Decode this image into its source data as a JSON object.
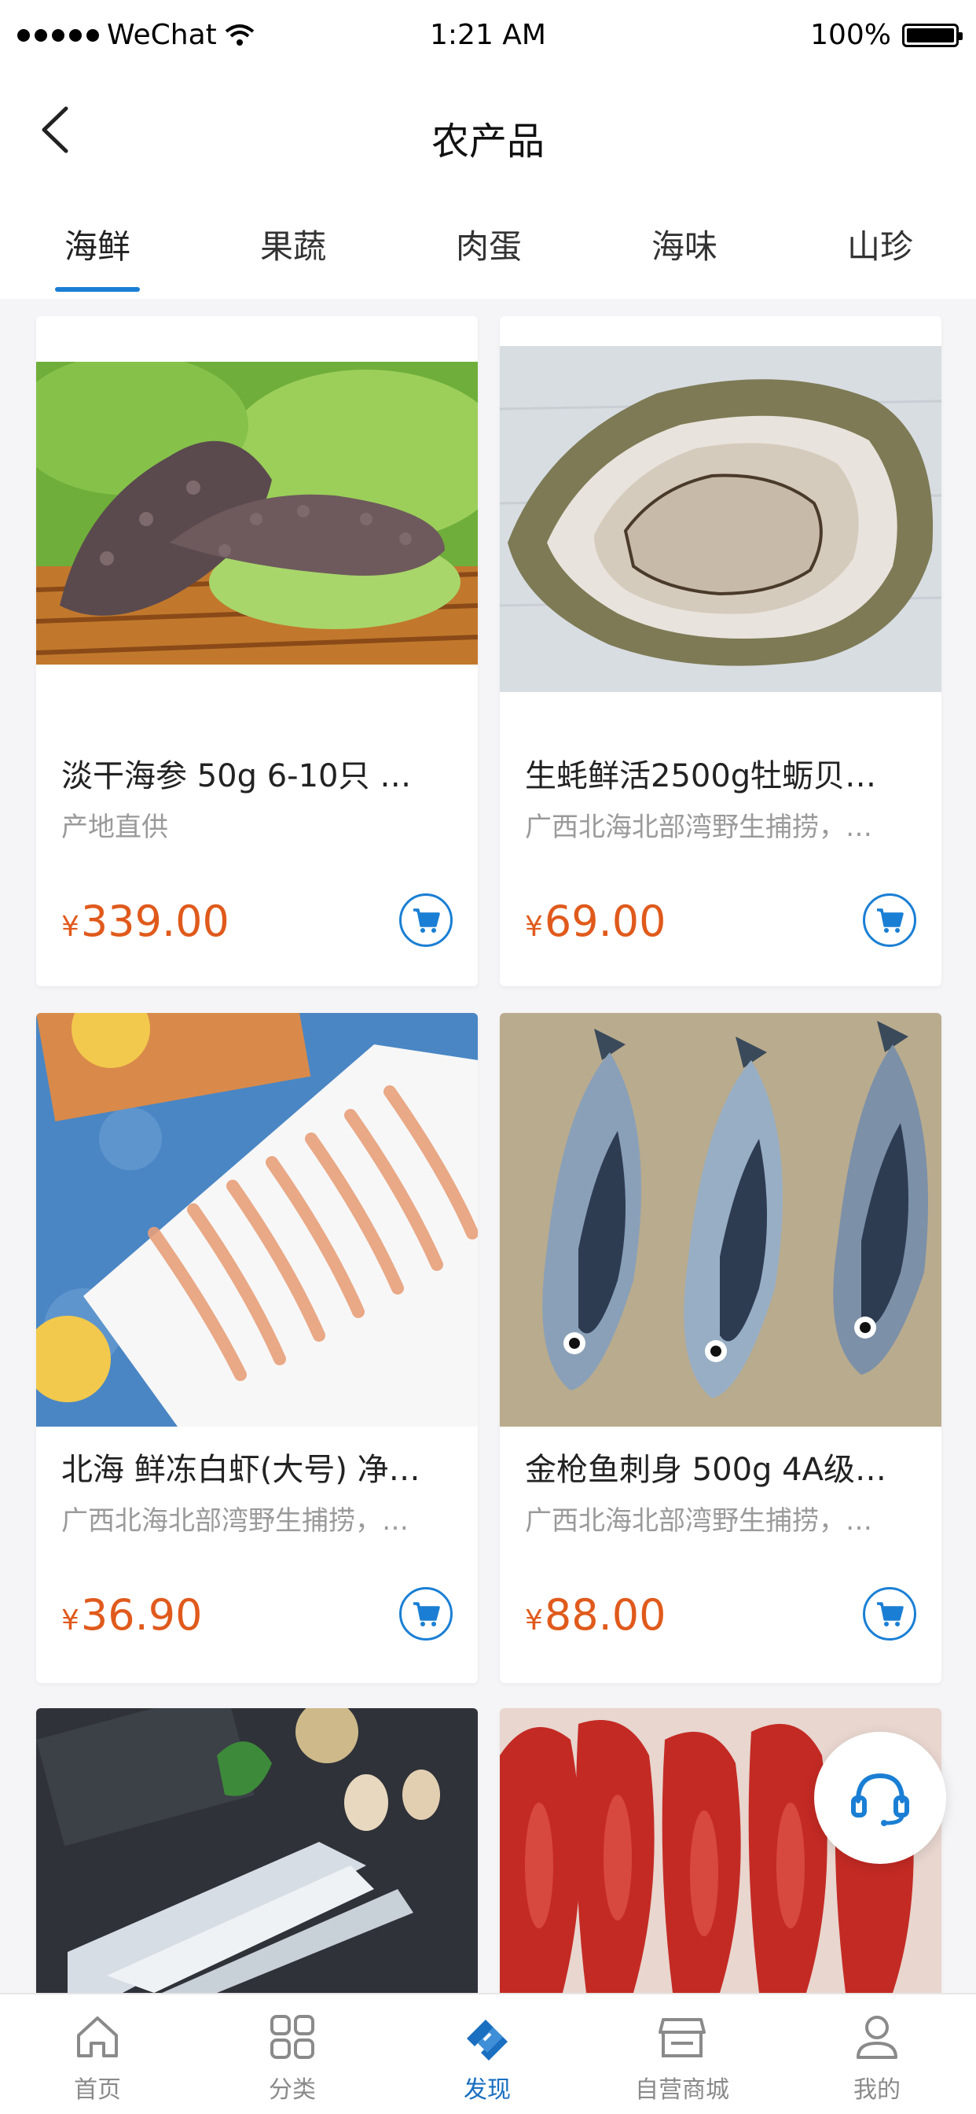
{
  "status_bar": {
    "carrier": "WeChat",
    "time": "1:21 AM",
    "battery": "100%"
  },
  "nav": {
    "title": "农产品"
  },
  "tabs": [
    {
      "label": "海鲜",
      "active": true
    },
    {
      "label": "果蔬",
      "active": false
    },
    {
      "label": "肉蛋",
      "active": false
    },
    {
      "label": "海味",
      "active": false
    },
    {
      "label": "山珍",
      "active": false
    }
  ],
  "products": [
    {
      "title": "淡干海参 50g 6-10只 …",
      "subtitle": "产地直供",
      "currency": "¥",
      "price": "339.00"
    },
    {
      "title": "生蚝鲜活2500g牡蛎贝…",
      "subtitle": "广西北海北部湾野生捕捞，…",
      "currency": "¥",
      "price": "69.00"
    },
    {
      "title": "北海 鲜冻白虾(大号) 净…",
      "subtitle": "广西北海北部湾野生捕捞，…",
      "currency": "¥",
      "price": "36.90"
    },
    {
      "title": "金枪鱼刺身 500g 4A级…",
      "subtitle": "广西北海北部湾野生捕捞，…",
      "currency": "¥",
      "price": "88.00"
    }
  ],
  "tabbar": [
    {
      "label": "首页",
      "icon": "home-icon",
      "active": false
    },
    {
      "label": "分类",
      "icon": "category-icon",
      "active": false
    },
    {
      "label": "发现",
      "icon": "discover-icon",
      "active": true
    },
    {
      "label": "自营商城",
      "icon": "store-icon",
      "active": false
    },
    {
      "label": "我的",
      "icon": "profile-icon",
      "active": false
    }
  ],
  "colors": {
    "accent": "#1a7fd4",
    "price": "#e05a1c"
  }
}
